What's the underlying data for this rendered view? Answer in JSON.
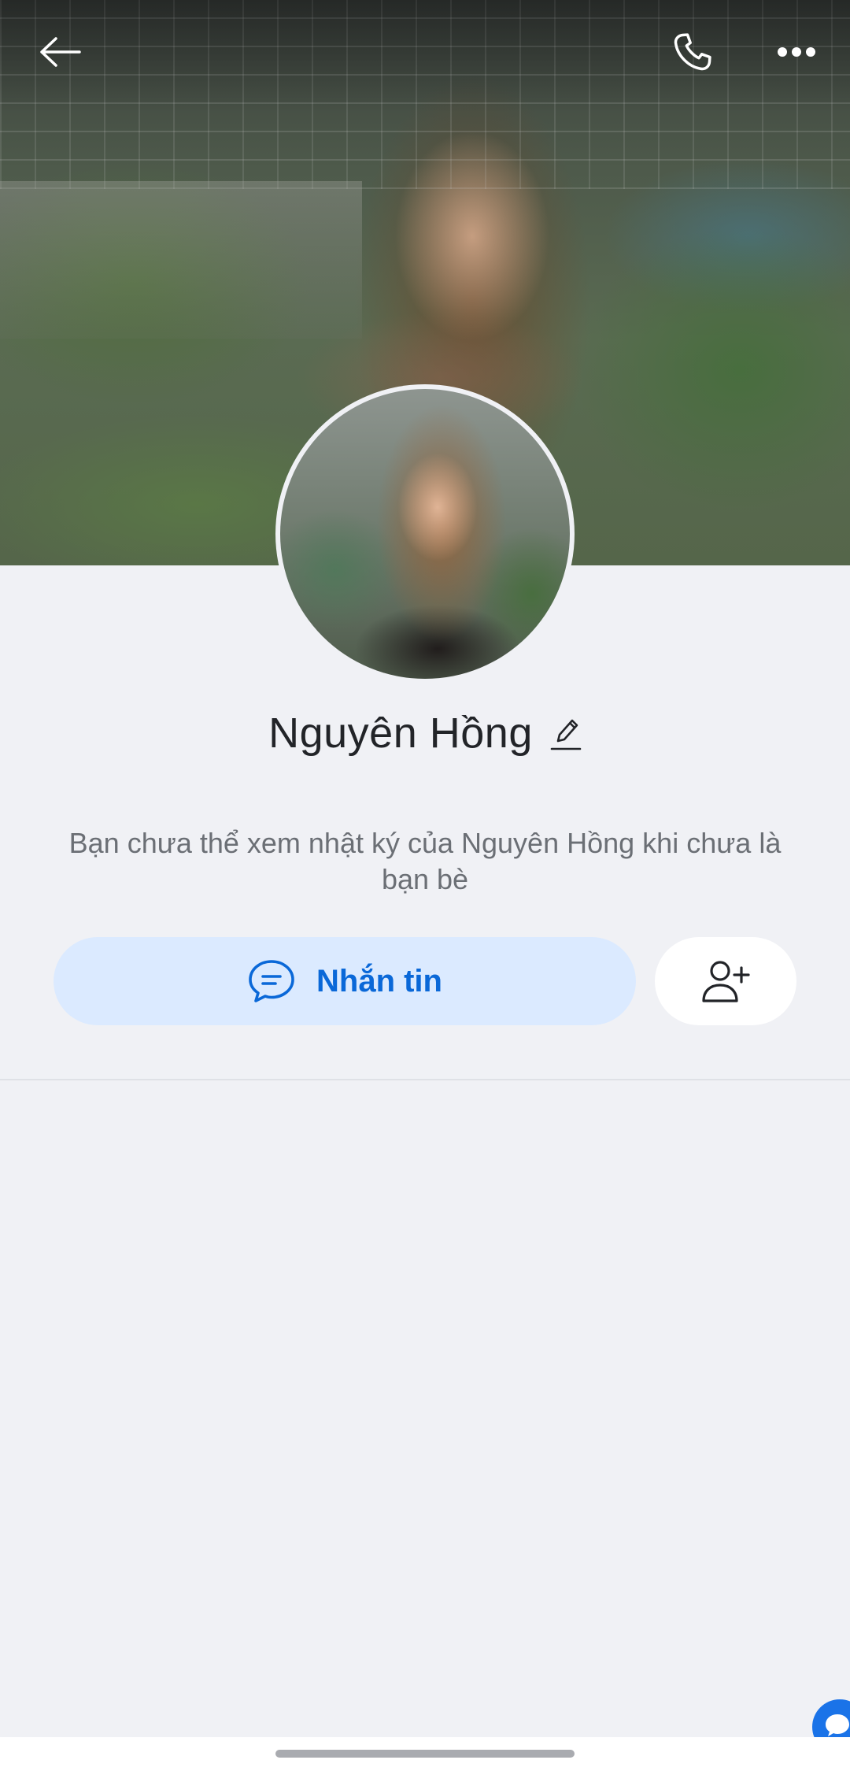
{
  "profile": {
    "name": "Nguyên Hồng",
    "notice": "Bạn chưa thể xem nhật ký của Nguyên Hồng khi chưa là bạn bè"
  },
  "actions": {
    "message_label": "Nhắn tin"
  },
  "icons": {
    "back": "arrow-left-icon",
    "call": "phone-icon",
    "more": "more-horizontal-icon",
    "edit": "pencil-icon",
    "message": "chat-bubble-icon",
    "add_friend": "user-plus-icon",
    "floating_chat": "chat-bubble-icon"
  },
  "colors": {
    "accent": "#0a68d8",
    "message_button_bg": "#dbeaff",
    "background": "#f0f1f5",
    "text_primary": "#222428",
    "text_secondary": "#6b6f75"
  }
}
